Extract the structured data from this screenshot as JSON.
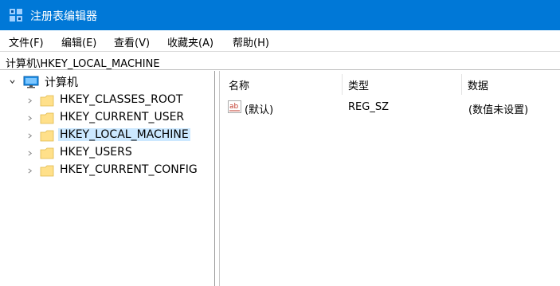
{
  "window": {
    "title": "注册表编辑器",
    "accent": "#0078d7"
  },
  "menu": {
    "items": [
      {
        "label": "文件(F)"
      },
      {
        "label": "编辑(E)"
      },
      {
        "label": "查看(V)"
      },
      {
        "label": "收藏夹(A)"
      },
      {
        "label": "帮助(H)"
      }
    ]
  },
  "address": {
    "path": "计算机\\HKEY_LOCAL_MACHINE"
  },
  "tree": {
    "root": {
      "label": "计算机",
      "icon": "computer-icon"
    },
    "children": [
      {
        "label": "HKEY_CLASSES_ROOT",
        "icon": "folder-icon"
      },
      {
        "label": "HKEY_CURRENT_USER",
        "icon": "folder-icon"
      },
      {
        "label": "HKEY_LOCAL_MACHINE",
        "icon": "folder-icon",
        "selected": true
      },
      {
        "label": "HKEY_USERS",
        "icon": "folder-icon"
      },
      {
        "label": "HKEY_CURRENT_CONFIG",
        "icon": "folder-icon"
      }
    ],
    "selected_color": "#cce8ff",
    "folder_color": "#ffe08a"
  },
  "list": {
    "headers": {
      "name": "名称",
      "type": "类型",
      "data": "数据"
    },
    "rows": [
      {
        "name": "(默认)",
        "type": "REG_SZ",
        "data": "(数值未设置)",
        "icon": "string-value-icon"
      }
    ]
  }
}
